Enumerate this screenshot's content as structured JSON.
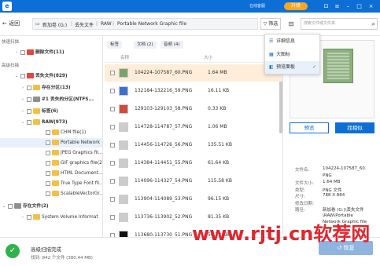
{
  "titlebar": {
    "links": [
      "在线客服",
      "升级"
    ],
    "window_icons": [
      "cart-icon",
      "menu-icon",
      "minimize-icon",
      "maximize-icon",
      "close-icon"
    ]
  },
  "nav": {
    "back": "返回",
    "breadcrumbs": [
      "新加卷 (G:)",
      "丢失文件",
      "RAW",
      "Portable Network Graphic file"
    ],
    "filter": "筛选",
    "search_placeholder": "搜索文件或文件夹"
  },
  "sidebar": {
    "quick_scan": "快速扫描",
    "deleted": "删除文件(11)",
    "advanced_scan": "高级扫描",
    "lost": "丢失文件(829)",
    "existing_partition": "存在分区(13)",
    "lost_partition": "#1 丢失的分区(NTFS...",
    "tags": "标签(6)",
    "raw": "RAW(973)",
    "raw_children": [
      "CHM file(1)",
      "Portable Network",
      "JPEG Graphics fil...",
      "GIF graphics file(2",
      "HTML Document...",
      "True Type Font fil...",
      "ScalableVectorGr..."
    ],
    "existing_files": "存在文件(2)",
    "sysvol": "System Volume Informat"
  },
  "list": {
    "chips": [
      "标签",
      "文档 (2)",
      "音频 (4)"
    ],
    "columns": {
      "name": "名称",
      "size": "大小"
    },
    "rows": [
      {
        "name": "104224-107587_60.PNG",
        "size": "1.64 MB"
      },
      {
        "name": "132184-132216_59.PNG",
        "size": "16.11 KB"
      },
      {
        "name": "129103-129103_58.PNG",
        "size": "0.33 KB"
      },
      {
        "name": "114728-114787_57.PNG",
        "size": "1.06 MB"
      },
      {
        "name": "114456-114726_56.PNG",
        "size": "135.51 KB"
      },
      {
        "name": "114384-114451_55.PNG",
        "size": "61.64 KB"
      },
      {
        "name": "114096-114327_54.PNG",
        "size": "115.58 KB"
      },
      {
        "name": "113904-114089_53.PNG",
        "size": "96.15 KB"
      },
      {
        "name": "113736-113902_52.PNG",
        "size": "81.35 KB"
      },
      {
        "name": "113680-113730_51.PNG",
        "size": "56.73 KB"
      }
    ]
  },
  "preview": {
    "btn_preview": "预览",
    "btn_find": "找相似",
    "kv": [
      {
        "k": "文件名:",
        "v": "104224-107587_60."
      },
      {
        "k": "",
        "v": "PNG"
      },
      {
        "k": "文件大小:",
        "v": "1.64 MB"
      },
      {
        "k": "类型:",
        "v": "PNG 文件"
      },
      {
        "k": "尺寸:",
        "v": "788 X 884"
      },
      {
        "k": "修改日期:",
        "v": ""
      },
      {
        "k": "路径:",
        "v": "新加卷 (G:)\\丢失文件"
      },
      {
        "k": "",
        "v": "\\RAW\\Portable"
      },
      {
        "k": "",
        "v": "Network Graphic file"
      }
    ]
  },
  "menu": {
    "items": [
      "详细信息",
      "大图标",
      "预览面板"
    ],
    "checked": "✓"
  },
  "footer": {
    "title": "高级扫描完成",
    "subtitle": "找到: 842 个文件 (380.44 MB)",
    "restore": "恢复"
  },
  "watermark": "www.rjtj.cn软荐网"
}
